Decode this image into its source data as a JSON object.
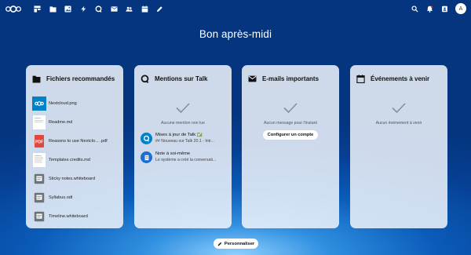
{
  "topbar": {
    "logo": "nextcloud-logo",
    "apps": [
      "dashboard-icon",
      "files-icon",
      "photos-icon",
      "activity-icon",
      "talk-icon",
      "mail-icon",
      "contacts-icon",
      "calendar-icon",
      "notes-icon"
    ],
    "right": [
      "search-icon",
      "notifications-icon",
      "contacts-menu-icon"
    ],
    "avatar_initial": "A"
  },
  "greeting": "Bon après-midi",
  "widgets": {
    "files": {
      "title": "Fichiers recommandés",
      "items": [
        {
          "name": "Nextcloud.png",
          "type": "image"
        },
        {
          "name": "Readme.md",
          "type": "doc"
        },
        {
          "name": "Reasons to use Nextclo... .pdf",
          "type": "pdf"
        },
        {
          "name": "Templates credits.md",
          "type": "doc"
        },
        {
          "name": "Sticky notes.whiteboard",
          "type": "whiteboard"
        },
        {
          "name": "Syllabus.odt",
          "type": "whiteboard"
        },
        {
          "name": "Timeline.whiteboard",
          "type": "whiteboard"
        }
      ]
    },
    "talk": {
      "title": "Mentions sur Talk",
      "empty": "Aucune mention non lue",
      "items": [
        {
          "title": "Mises à jour de Talk ✅",
          "subtitle": "## Nouveau sur Talk 20.1 - Intr..."
        },
        {
          "title": "Note à soi-même",
          "subtitle": "Le système a créé la conversati..."
        }
      ]
    },
    "mail": {
      "title": "E-mails importants",
      "empty": "Aucun message pour l'instant",
      "button": "Configurer un compte"
    },
    "calendar": {
      "title": "Événements à venir",
      "empty": "Aucun événement à venir"
    }
  },
  "customize_button": "Personnaliser",
  "colors": {
    "accent": "#0082c9",
    "background": "#0a5bb8",
    "card": "#f0f5fc"
  }
}
